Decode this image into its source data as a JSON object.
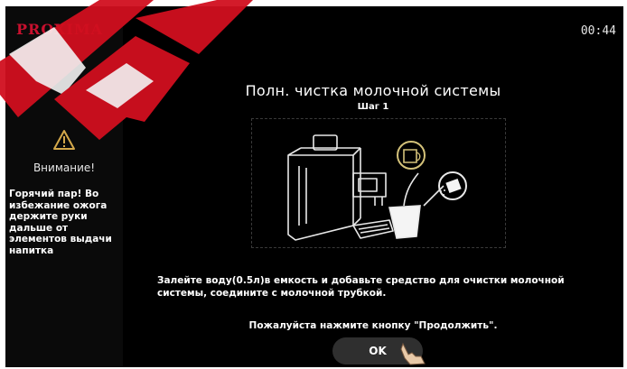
{
  "header": {
    "logo": "PROXIMA",
    "clock": "00:44"
  },
  "sidebar": {
    "warning_title": "Внимание!",
    "warning_text": "Горячий пар! Во избежание ожога держите руки дальше от элементов выдачи напитка"
  },
  "main": {
    "title": "Полн. чистка молочной системы",
    "step": "Шаг 1",
    "instruction": "Залейте воду(0.5л)в емкость и  добавьте  средство для очистки  молочной системы, соедините с молочной трубкой.",
    "prompt": "Пожалуйста нажмите кнопку \"Продолжить\".",
    "ok_label": "OK"
  },
  "watermark": {
    "text": "PRO",
    "color": "#d10f1f"
  },
  "colors": {
    "background": "#000000",
    "accent": "#d4c27a",
    "logo": "#c8102e"
  }
}
